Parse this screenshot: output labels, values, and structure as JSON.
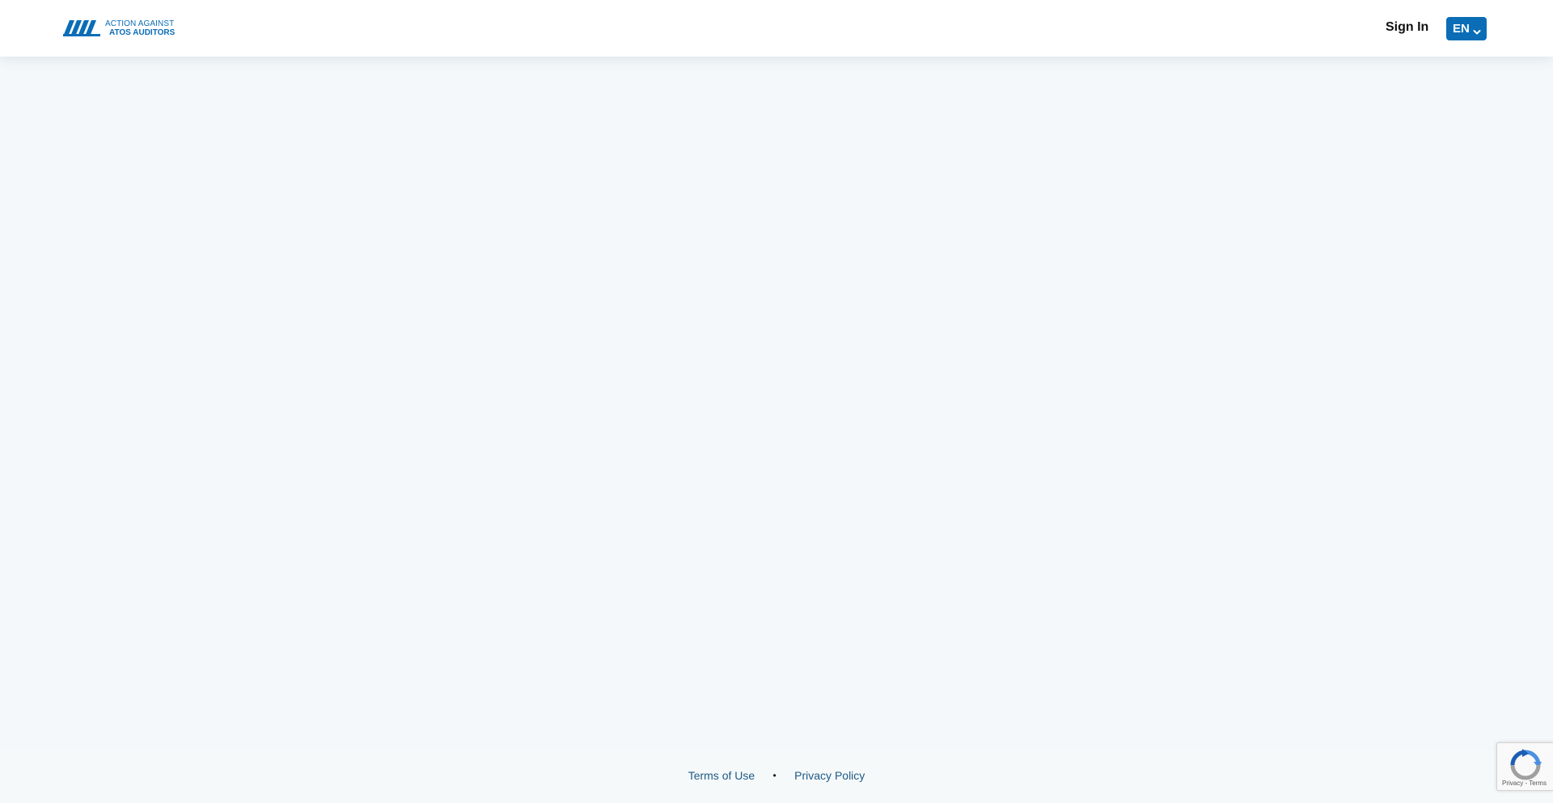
{
  "header": {
    "logo": {
      "line1": "ACTION AGAINST",
      "line2": "ATOS AUDITORS",
      "icon": "mountain-stripes-logo-icon"
    },
    "signin_label": "Sign In",
    "language": {
      "selected": "EN",
      "icon": "chevron-down-icon"
    }
  },
  "footer": {
    "terms_label": "Terms of Use",
    "separator": "•",
    "privacy_label": "Privacy Policy"
  },
  "recaptcha": {
    "icon": "recaptcha-icon",
    "text": "Privacy - Terms"
  },
  "colors": {
    "brand": "#0a6db6",
    "background": "#f4f8fa",
    "footer_link": "#1d5a86"
  }
}
